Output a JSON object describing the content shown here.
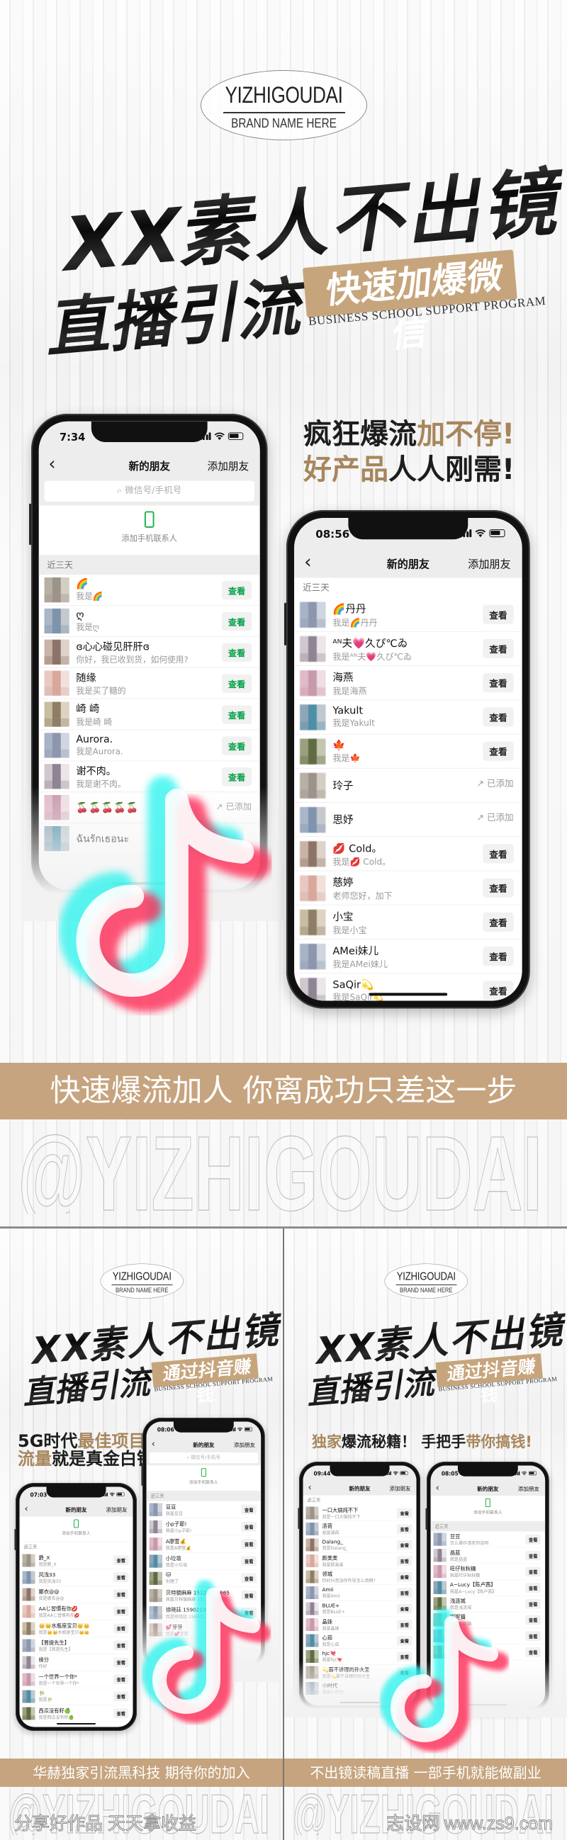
{
  "brand": {
    "name": "YIZHIGOUDAI",
    "tagline": "BRAND NAME HERE"
  },
  "colors": {
    "gold_banner": "#c6a47f",
    "gold_text": "#a7865c",
    "dark_text": "#1d1d1d",
    "wechat_green": "#1db04b",
    "tiktok_cyan": "#25f4ee",
    "tiktok_red": "#fe2c55"
  },
  "posters": [
    {
      "headline1": "XX素人不出镜",
      "headline2": "直播引流",
      "tag": "快速加爆微信",
      "subtitle": "BUSINESS SCHOOL SUPPORT PROGRAM",
      "slogan": [
        [
          {
            "text": "疯狂爆流",
            "tone": "dark"
          },
          {
            "text": "加不停!",
            "tone": "gold"
          }
        ],
        [
          {
            "text": "好产品",
            "tone": "gold"
          },
          {
            "text": "人人刚需!",
            "tone": "dark"
          }
        ]
      ],
      "banner": "快速爆流加人 你离成功只差这一步",
      "watermark": "@YIZHIGOUDAI",
      "logo_icon": "tiktok-logo-icon"
    },
    {
      "headline1": "XX素人不出镜",
      "headline2": "直播引流",
      "tag": "通过抖音赚钱",
      "subtitle": "BUSINESS SCHOOL SUPPORT PROGRAM",
      "slogan": [
        [
          {
            "text": "5G时代",
            "tone": "dark"
          },
          {
            "text": "最佳项目",
            "tone": "gold"
          }
        ],
        [
          {
            "text": "流量",
            "tone": "gold"
          },
          {
            "text": "就是真金白银",
            "tone": "dark"
          }
        ]
      ],
      "banner": "华赫独家引流黑科技 期待你的加入",
      "watermark": "@YIZHIGOUDAI",
      "footer": "分享好作品 天天拿收益",
      "logo_icon": "tiktok-logo-icon"
    },
    {
      "headline1": "XX素人不出镜",
      "headline2": "直播引流",
      "tag": "通过抖音赚钱",
      "subtitle": "BUSINESS SCHOOL SUPPORT PROGRAM",
      "slogan": [
        [
          {
            "text": "独家",
            "tone": "gold"
          },
          {
            "text": "爆流秘籍！ 手把手",
            "tone": "dark"
          },
          {
            "text": "带你搞钱!",
            "tone": "gold"
          }
        ]
      ],
      "banner": "不出镜读稿直播 一部手机就能做副业",
      "watermark": "@YIZHIGOUDAI",
      "footer": "志设网 www.zs9.com",
      "logo_icon": "tiktok-logo-icon"
    }
  ],
  "phones": [
    {
      "time": "7:34",
      "title": "新的朋友",
      "add_label": "添加朋友",
      "search": "微信号/手机号",
      "add_contact": "添加手机联系人",
      "section": "近三天",
      "action_color": "#07a14a",
      "rows": [
        {
          "name": "🌈",
          "sub": "我是🌈",
          "action": "查看"
        },
        {
          "name": "ღ",
          "sub": "我是ღ",
          "action": "查看"
        },
        {
          "name": "ɞ心心碰见肝肝ɞ",
          "sub": "你好，我已收到货，如何使用?",
          "action": "查看"
        },
        {
          "name": "随缘",
          "sub": "我是买了糖的",
          "action": "查看"
        },
        {
          "name": "崎 崎",
          "sub": "我是崎 崎",
          "action": "查看"
        },
        {
          "name": "Aurora.",
          "sub": "我是Aurora.",
          "action": "查看"
        },
        {
          "name": "谢不肉。",
          "sub": "我是谢不肉。",
          "action": "查看"
        },
        {
          "name": "🍒🍒🍒🍒🍒",
          "sub": "",
          "action": "已添加",
          "added": true
        },
        {
          "name": "ฉันรักเธอนะ",
          "sub": "",
          "action": ""
        }
      ]
    },
    {
      "time": "08:56",
      "title": "新的朋友",
      "add_label": "添加朋友",
      "section": "近三天",
      "action_color": "#222222",
      "rows": [
        {
          "name": "🌈丹丹",
          "sub": "我是🌈丹丹",
          "action": "查看"
        },
        {
          "name": "ᴬᴺ夫💗久ぴ℃ゐ",
          "sub": "我是ᴬᴺ夫💗久ぴ℃ゐ",
          "action": "查看"
        },
        {
          "name": "海燕",
          "sub": "我是海燕",
          "action": "查看"
        },
        {
          "name": "Yakult",
          "sub": "我是Yakult",
          "action": "查看"
        },
        {
          "name": "🍁",
          "sub": "我是🍁",
          "action": "查看"
        },
        {
          "name": "玲子",
          "sub": "",
          "action": "已添加",
          "added": true
        },
        {
          "name": "思妤",
          "sub": "",
          "action": "已添加",
          "added": true
        },
        {
          "name": "💋 Cold。",
          "sub": "我是💋 Cold。",
          "action": "查看"
        },
        {
          "name": "慈婷",
          "sub": "老师您好，加下",
          "action": "查看"
        },
        {
          "name": "小宝",
          "sub": "我是小宝",
          "action": "查看"
        },
        {
          "name": "AMei妹儿",
          "sub": "我是AMei妹儿",
          "action": "查看"
        },
        {
          "name": "SaQir💫",
          "sub": "我是SaQir💫",
          "action": "查看"
        }
      ]
    },
    {
      "time": "07:03",
      "title": "新的朋友",
      "add_label": "添加朋友",
      "add_contact": "添加手机联系人",
      "section": "近三天",
      "action_color": "#222222",
      "rows": [
        {
          "name": "爵_X",
          "sub": "我是爵_X",
          "action": "查看"
        },
        {
          "name": "风浅33",
          "sub": "我是风浅33",
          "action": "查看"
        },
        {
          "name": "娜衣@@",
          "sub": "我是娜衣@@",
          "action": "查看"
        },
        {
          "name": "AAじ習慣有你💋",
          "sub": "我是AAじ習慣有你💋",
          "action": "查看"
        },
        {
          "name": "👑👑水瓶座宝贝👑👑",
          "sub": "我是👑👑水瓶座宝贝👑👑",
          "action": "查看"
        },
        {
          "name": "【晋提先生】",
          "sub": "我是【晋提先生】",
          "action": "查看"
        },
        {
          "name": "缘分",
          "sub": "你好",
          "action": "查看"
        },
        {
          "name": "一个世界一个你*",
          "sub": "我是一个世界一个你*",
          "action": "查看"
        },
        {
          "name": "🎋",
          "sub": "我是🎋",
          "action": "查看"
        },
        {
          "name": "西瓜没有籽🍏",
          "sub": "我是西瓜没有籽🍏",
          "action": "查看"
        }
      ]
    },
    {
      "time": "08:06",
      "title": "新的朋友",
      "add_label": "添加朋友",
      "search": "微信号/手机号",
      "add_contact": "添加手机联系人",
      "section": "近三天",
      "action_color": "#222222",
      "rows": [
        {
          "name": "豆豆",
          "sub": "我是豆豆",
          "action": "查看"
        },
        {
          "name": "小p子耶!",
          "sub": "我是小p子耶!",
          "action": "查看"
        },
        {
          "name": "A廖萱💰",
          "sub": "我是A廖萱💰",
          "action": "查看"
        },
        {
          "name": "小垃圾",
          "sub": "我是小垃圾",
          "action": "查看"
        },
        {
          "name": "🐱",
          "sub": "别理了",
          "action": "查看"
        },
        {
          "name": "贝特貌麻麻 15121210665",
          "sub": "我是贝特貌麻麻 15121210665",
          "action": "查看"
        },
        {
          "name": "徐晓廷 15902135257",
          "sub": "我是徐晓廷 15902135257",
          "action": "查看"
        },
        {
          "name": "💕芽芽",
          "sub": "我是💕芽芽",
          "action": "查看"
        }
      ]
    },
    {
      "time": "09:44",
      "title": "新的朋友",
      "add_label": "添加朋友",
      "section": "近三天",
      "action_color": "#222222",
      "rows": [
        {
          "name": "一口大锅炖不下",
          "sub": "我是一口大锅炖不下",
          "action": "查看"
        },
        {
          "name": "清荷",
          "sub": "我是清荷",
          "action": "查看"
        },
        {
          "name": "Dalang_",
          "sub": "我是Dalang_",
          "action": "查看"
        },
        {
          "name": "颜美美",
          "sub": "我是颜美美",
          "action": "查看"
        },
        {
          "name": "领城",
          "sub": "你好抖音加你咋导怎么用啊?",
          "action": "查看"
        },
        {
          "name": "Amii",
          "sub": "我是Amii",
          "action": "查看"
        },
        {
          "name": "BLUE+",
          "sub": "我是BLUE+",
          "action": "查看"
        },
        {
          "name": "晶妹",
          "sub": "我是晶妹",
          "action": "查看"
        },
        {
          "name": "心茹",
          "sub": "我是心茹",
          "action": "查看"
        },
        {
          "name": "hjc💘",
          "sub": "我是hjc💘",
          "action": "查看"
        },
        {
          "name": "💫霸不讲理的孙大圣",
          "sub": "我是💫霸不讲理的孙大圣",
          "action": "查看"
        },
        {
          "name": "小时代",
          "sub": "我是小时代",
          "action": "查看"
        }
      ]
    },
    {
      "time": "08:05",
      "title": "新的朋友",
      "add_label": "添加朋友",
      "add_contact": "添加手机联系人",
      "section": "近三天",
      "action_color": "#222222",
      "rows": [
        {
          "name": "豆豆",
          "sub": "怎么操作请老师说明",
          "action": "查看"
        },
        {
          "name": "晶蓝",
          "sub": "我是晶蓝",
          "action": "查看"
        },
        {
          "name": "旺仔秋秋糖",
          "sub": "我是旺仔秋秋糖",
          "action": "查看"
        },
        {
          "name": "A~Lucy【陈卢茜】",
          "sub": "我是A~Lucy【陈卢茜】",
          "action": "查看"
        },
        {
          "name": "浅涟城",
          "sub": "我是浅涟城",
          "action": "查看"
        },
        {
          "name": "妮妮猫",
          "sub": "我是妮妮猫",
          "action": "查看"
        },
        {
          "name": "LovL",
          "sub": "我是LovL",
          "action": "查看"
        },
        {
          "name": "谢巧月",
          "sub": "我是谢巧月",
          "action": "查看"
        }
      ]
    }
  ]
}
